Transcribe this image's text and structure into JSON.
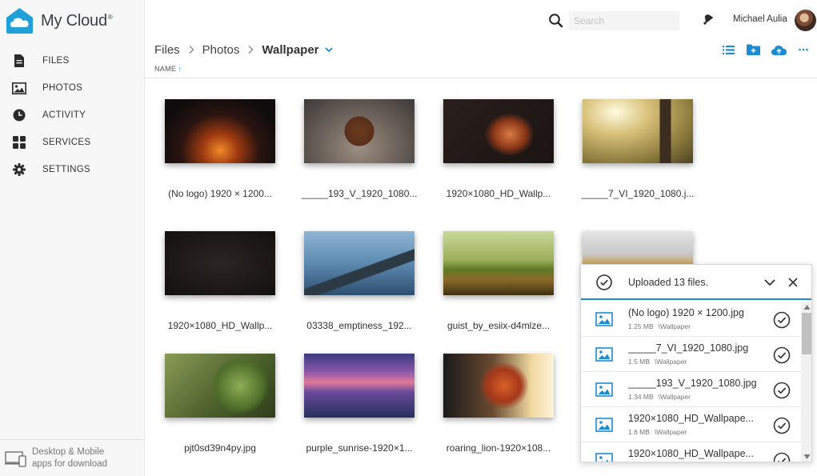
{
  "app": {
    "name": "My Cloud",
    "mark": "®"
  },
  "colors": {
    "accent": "#1e8bd1",
    "logo": "#20a0d8",
    "text": "#333333"
  },
  "sidebar": {
    "items": [
      {
        "label": "FILES",
        "icon": "file-icon"
      },
      {
        "label": "PHOTOS",
        "icon": "image-icon"
      },
      {
        "label": "ACTIVITY",
        "icon": "clock-icon"
      },
      {
        "label": "SERVICES",
        "icon": "grid-icon"
      },
      {
        "label": "SETTINGS",
        "icon": "gear-icon"
      }
    ],
    "footer": {
      "line1": "Desktop & Mobile",
      "line2": "apps for download",
      "icon": "devices-icon"
    }
  },
  "header": {
    "search_placeholder": "Search",
    "user_name": "Michael Aulia"
  },
  "breadcrumb": {
    "items": [
      "Files",
      "Photos"
    ],
    "current": "Wallpaper"
  },
  "toolbar": {
    "icons": [
      "list-view-icon",
      "new-folder-icon",
      "upload-cloud-icon",
      "more-icon"
    ]
  },
  "sort": {
    "label": "NAME",
    "direction": "ascending"
  },
  "files": [
    {
      "name": "(No logo) 1920 × 1200..."
    },
    {
      "name": "_____193_V_1920_1080..."
    },
    {
      "name": "1920×1080_HD_Wallp..."
    },
    {
      "name": "_____7_VI_1920_1080.j..."
    },
    {
      "name": "1920×1080_HD_Wallp..."
    },
    {
      "name": "03338_emptiness_192..."
    },
    {
      "name": "guist_by_esiix-d4mlze..."
    },
    {
      "name": ""
    },
    {
      "name": "pjt0sd39n4py.jpg"
    },
    {
      "name": "purple_sunrise-1920×1..."
    },
    {
      "name": "roaring_lion-1920×108..."
    }
  ],
  "upload_panel": {
    "title": "Uploaded 13 files.",
    "items": [
      {
        "name": "(No logo) 1920 × 1200.jpg",
        "size": "1.25 MB",
        "path": "\\Wallpaper"
      },
      {
        "name": "_____7_VI_1920_1080.jpg",
        "size": "1.5 MB",
        "path": "\\Wallpaper"
      },
      {
        "name": "_____193_V_1920_1080.jpg",
        "size": "1.34 MB",
        "path": "\\Wallpaper"
      },
      {
        "name": "1920×1080_HD_Wallpape...",
        "size": "1.6 MB",
        "path": "\\Wallpaper"
      },
      {
        "name": "1920×1080_HD_Wallpape...",
        "size": "",
        "path": ""
      }
    ]
  }
}
